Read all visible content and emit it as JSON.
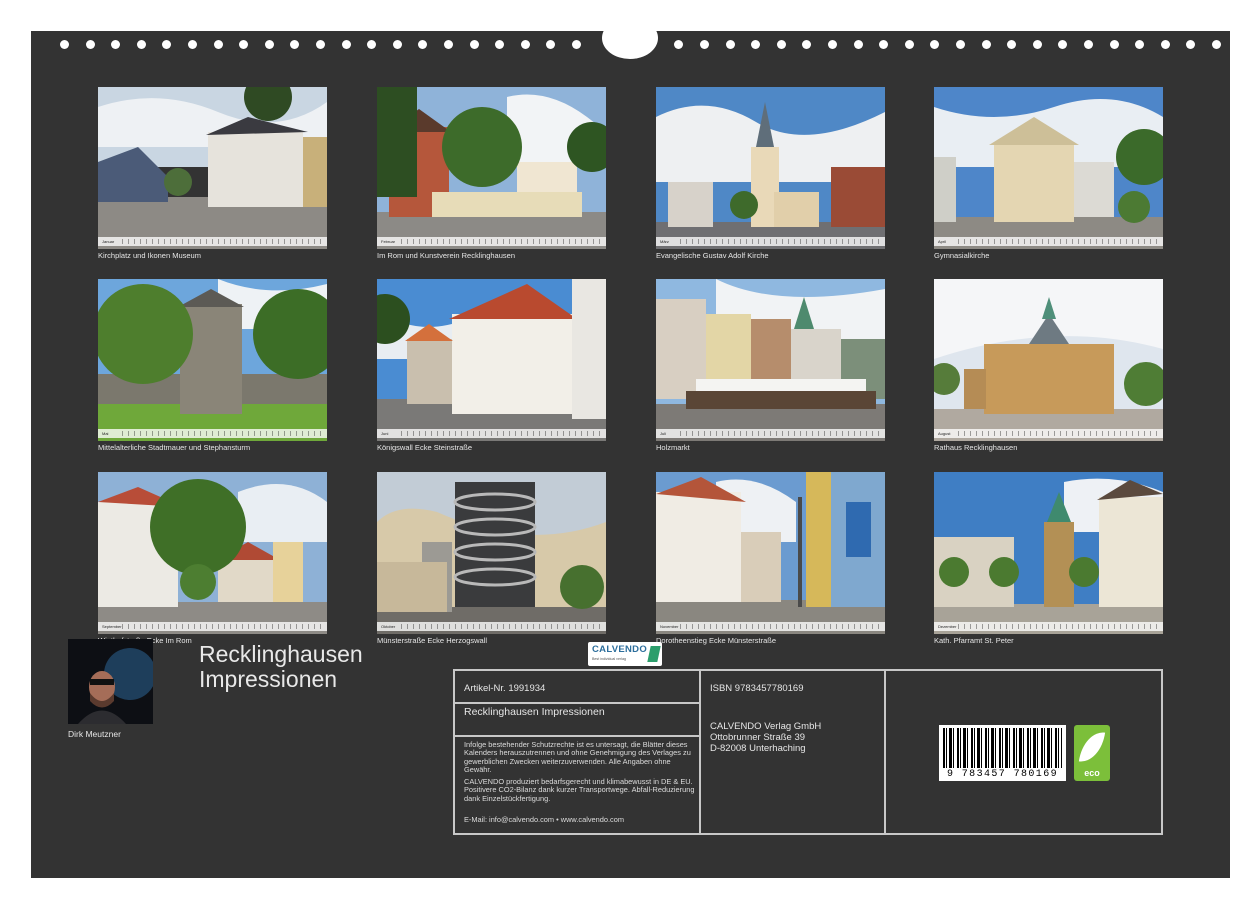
{
  "title": [
    "Recklinghausen",
    "Impressionen"
  ],
  "author": "Dirk Meutzner",
  "tiles": [
    {
      "caption": "Kirchplatz und Ikonen Museum",
      "month": "Januar"
    },
    {
      "caption": "Im Rom und Kunstverein Recklinghausen",
      "month": "Februar"
    },
    {
      "caption": "Evangelische Gustav Adolf Kirche",
      "month": "März"
    },
    {
      "caption": "Gymnasialkirche",
      "month": "April"
    },
    {
      "caption": "Mittelalterliche Stadtmauer und Stephansturm",
      "month": "Mai"
    },
    {
      "caption": "Königswall Ecke Steinstraße",
      "month": "Juni"
    },
    {
      "caption": "Holzmarkt",
      "month": "Juli"
    },
    {
      "caption": "Rathaus Recklinghausen",
      "month": "August"
    },
    {
      "caption": "Wiethofstraße Ecke Im Rom",
      "month": "September"
    },
    {
      "caption": "Münsterstraße Ecke Herzogswall",
      "month": "Oktober"
    },
    {
      "caption": "Dorotheenstieg Ecke Münsterstraße",
      "month": "November"
    },
    {
      "caption": "Kath. Pfarramt St. Peter",
      "month": "Dezember"
    }
  ],
  "info": {
    "article": "Artikel-Nr. 1991934",
    "logo": "CALVENDO",
    "logo_sub": "Best individual verlag",
    "product": "Recklinghausen Impressionen",
    "legal1": "Infolge bestehender Schutzrechte ist es untersagt, die Blätter dieses Kalenders herauszutrennen und ohne Genehmigung des Verlages zu gewerblichen Zwecken weiterzuverwenden. Alle Angaben ohne Gewähr.",
    "legal2": "CALVENDO produziert bedarfsgerecht und klimabewusst in DE & EU. Positivere CO2-Bilanz dank kurzer Transportwege. Abfall-Reduzierung dank Einzelstückfertigung.",
    "contact": "E-Mail: info@calvendo.com • www.calvendo.com",
    "isbn": "ISBN 9783457780169",
    "publisher": [
      "CALVENDO Verlag GmbH",
      "Ottobrunner Straße 39",
      "D-82008 Unterhaching"
    ],
    "barcode_text": "9 783457 780169",
    "eco_label": "eco"
  }
}
